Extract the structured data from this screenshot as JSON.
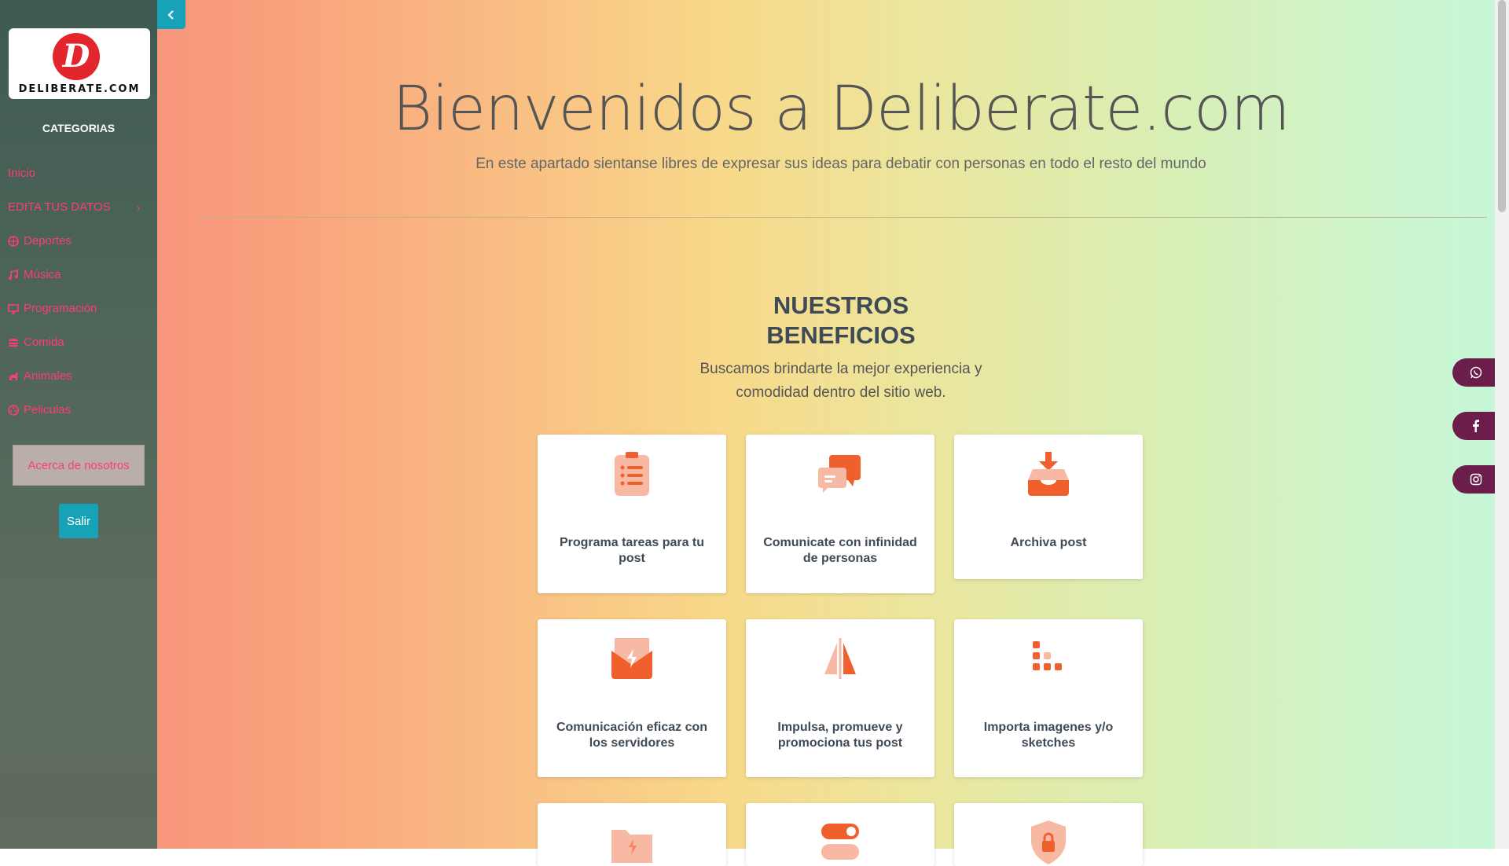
{
  "brand": {
    "logo_letter": "D",
    "logo_text": "DELIBERATE.COM"
  },
  "sidebar": {
    "heading": "CATEGORIAS",
    "items": [
      {
        "label": "Inicio",
        "icon": "none"
      },
      {
        "label": "EDITA TUS DATOS",
        "icon": "chevron-right"
      },
      {
        "label": "Deportes",
        "icon": "basketball-icon"
      },
      {
        "label": "Música",
        "icon": "music-icon"
      },
      {
        "label": "Programación",
        "icon": "desktop-icon"
      },
      {
        "label": "Comida",
        "icon": "burger-icon"
      },
      {
        "label": "Animales",
        "icon": "dog-icon"
      },
      {
        "label": "Peliculas",
        "icon": "film-icon"
      }
    ],
    "about_label": "Acerca de nosotros",
    "logout_label": "Salir"
  },
  "hero": {
    "title": "Bienvenidos a Deliberate.com",
    "subtitle": "En este apartado sientanse libres de expresar sus ideas para debatir con personas en todo el resto del mundo"
  },
  "benefits": {
    "title_line1": "NUESTROS",
    "title_line2": "BENEFICIOS",
    "subtitle_line1": "Buscamos brindarte la mejor experiencia y",
    "subtitle_line2": "comodidad dentro del sitio web.",
    "cards": [
      {
        "label": "Programa tareas para tu post",
        "icon": "clipboard-list-icon"
      },
      {
        "label": "Comunicate con infinidad de personas",
        "icon": "chat-bubbles-icon"
      },
      {
        "label": "Archiva post",
        "icon": "archive-tray-icon"
      },
      {
        "label": "Comunicación eficaz con los servidores",
        "icon": "lightning-mail-icon"
      },
      {
        "label": "Impulsa, promueve y promociona tus post",
        "icon": "split-triangle-icon"
      },
      {
        "label": "Importa imagenes y/o sketches",
        "icon": "dots-grid-icon"
      }
    ]
  },
  "social": [
    {
      "name": "whatsapp-icon"
    },
    {
      "name": "facebook-icon"
    },
    {
      "name": "instagram-icon"
    }
  ],
  "colors": {
    "accent": "#17a2b8",
    "link": "#ff3c74",
    "icon_orange": "#f0602d",
    "icon_light": "#f7b9a3",
    "social_bg": "#6b1d4b"
  }
}
